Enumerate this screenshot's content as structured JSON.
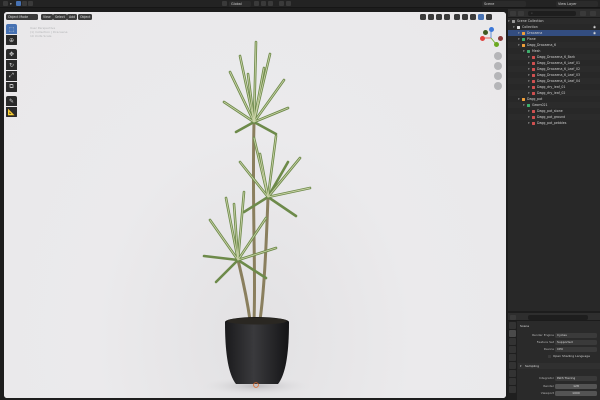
{
  "topbar": {
    "scene_label": "Scene",
    "view_layer_label": "View Layer",
    "global_label": "Global",
    "options_label": "Options"
  },
  "viewport": {
    "mode_label": "Object Mode",
    "menus": [
      "View",
      "Select",
      "Add",
      "Object"
    ],
    "overlay_lines": [
      "User Perspective",
      "(1) Collection | Dracaena",
      "10 Units Scale"
    ]
  },
  "outliner": {
    "search_placeholder": "",
    "rows": [
      {
        "label": "Scene Collection",
        "indent": 0,
        "icon": "collection-icon",
        "icon_color": "#9a9a9a",
        "selected": false,
        "eye": false
      },
      {
        "label": "Collection",
        "indent": 1,
        "icon": "collection-icon",
        "icon_color": "#e0e0e0",
        "selected": false,
        "eye": true
      },
      {
        "label": "Dracaena",
        "indent": 2,
        "icon": "object-icon",
        "icon_color": "#f09f3a",
        "selected": true,
        "eye": true
      },
      {
        "label": "Plane",
        "indent": 2,
        "icon": "mesh-icon",
        "icon_color": "#3fb06e",
        "selected": false,
        "eye": false
      },
      {
        "label": "Dagg_Dracaena_6",
        "indent": 2,
        "icon": "object-icon",
        "icon_color": "#f09f3a",
        "selected": false,
        "eye": false
      },
      {
        "label": "Mesh",
        "indent": 3,
        "icon": "mesh-icon",
        "icon_color": "#3fb06e",
        "selected": false,
        "eye": false
      },
      {
        "label": "Dagg_Dracaena_6_Bark",
        "indent": 4,
        "icon": "material-icon",
        "icon_color": "#d05050",
        "selected": false,
        "eye": false
      },
      {
        "label": "Dagg_Dracaena_6_Leaf_01",
        "indent": 4,
        "icon": "material-icon",
        "icon_color": "#d05050",
        "selected": false,
        "eye": false
      },
      {
        "label": "Dagg_Dracaena_6_Leaf_02",
        "indent": 4,
        "icon": "material-icon",
        "icon_color": "#d05050",
        "selected": false,
        "eye": false
      },
      {
        "label": "Dagg_Dracaena_6_Leaf_03",
        "indent": 4,
        "icon": "material-icon",
        "icon_color": "#d05050",
        "selected": false,
        "eye": false
      },
      {
        "label": "Dagg_Dracaena_6_Leaf_04",
        "indent": 4,
        "icon": "material-icon",
        "icon_color": "#d05050",
        "selected": false,
        "eye": false
      },
      {
        "label": "Dagg_dry_leaf_01",
        "indent": 4,
        "icon": "material-icon",
        "icon_color": "#d05050",
        "selected": false,
        "eye": false
      },
      {
        "label": "Dagg_dry_leaf_02",
        "indent": 4,
        "icon": "material-icon",
        "icon_color": "#d05050",
        "selected": false,
        "eye": false
      },
      {
        "label": "Dagg_pot",
        "indent": 2,
        "icon": "object-icon",
        "icon_color": "#f09f3a",
        "selected": false,
        "eye": false
      },
      {
        "label": "Geom021",
        "indent": 3,
        "icon": "mesh-icon",
        "icon_color": "#3fb06e",
        "selected": false,
        "eye": false
      },
      {
        "label": "Dagg_pot_stone",
        "indent": 4,
        "icon": "material-icon",
        "icon_color": "#d05050",
        "selected": false,
        "eye": false
      },
      {
        "label": "Dagg_pot_ground",
        "indent": 4,
        "icon": "material-icon",
        "icon_color": "#d05050",
        "selected": false,
        "eye": false
      },
      {
        "label": "Dagg_pot_pebbles",
        "indent": 4,
        "icon": "material-icon",
        "icon_color": "#d05050",
        "selected": false,
        "eye": false
      }
    ]
  },
  "properties": {
    "title": "Scene",
    "render_engine_label": "Render Engine",
    "render_engine_value": "Cycles",
    "feature_set_label": "Feature Set",
    "feature_set_value": "Supported",
    "device_label": "Device",
    "device_value": "CPU",
    "osl_label": "Open Shading Language",
    "sampling_label": "Sampling",
    "integrator_label": "Integrator",
    "integrator_value": "Path Tracing",
    "render_label": "Render",
    "render_value": "128",
    "viewport_label": "Viewport",
    "viewport_value": "1000"
  },
  "colors": {
    "accent": "#4772b3",
    "selection": "#334d80",
    "viewport_bg": "#e9e8ea",
    "axis_x": "#e0403c",
    "axis_y": "#6aa820",
    "axis_z": "#3c78d8"
  }
}
